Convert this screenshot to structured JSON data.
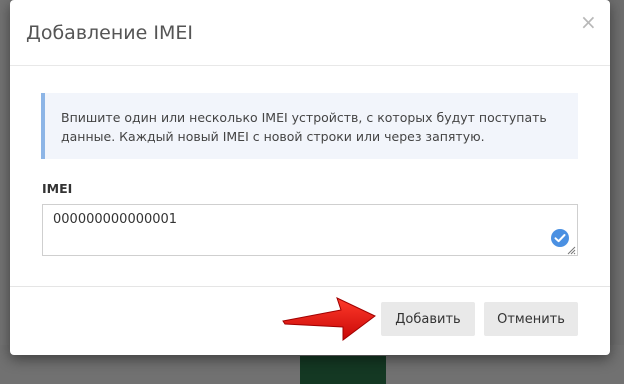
{
  "modal": {
    "title": "Добавление IMEI",
    "close_glyph": "×",
    "info_text": "Впишите один или несколько IMEI устройств, с которых будут поступать данные. Каждый новый IMEI с новой строки или через запятую.",
    "field_label": "IMEI",
    "imei_value": "000000000000001",
    "add_label": "Добавить",
    "cancel_label": "Отменить"
  },
  "icons": {
    "close": "close-icon",
    "valid": "check-circle-icon",
    "arrow": "red-arrow-pointer"
  },
  "colors": {
    "info_border": "#8db5e6",
    "info_bg": "#f2f5fb",
    "valid_icon": "#4a90e2",
    "arrow": "#e01010"
  }
}
